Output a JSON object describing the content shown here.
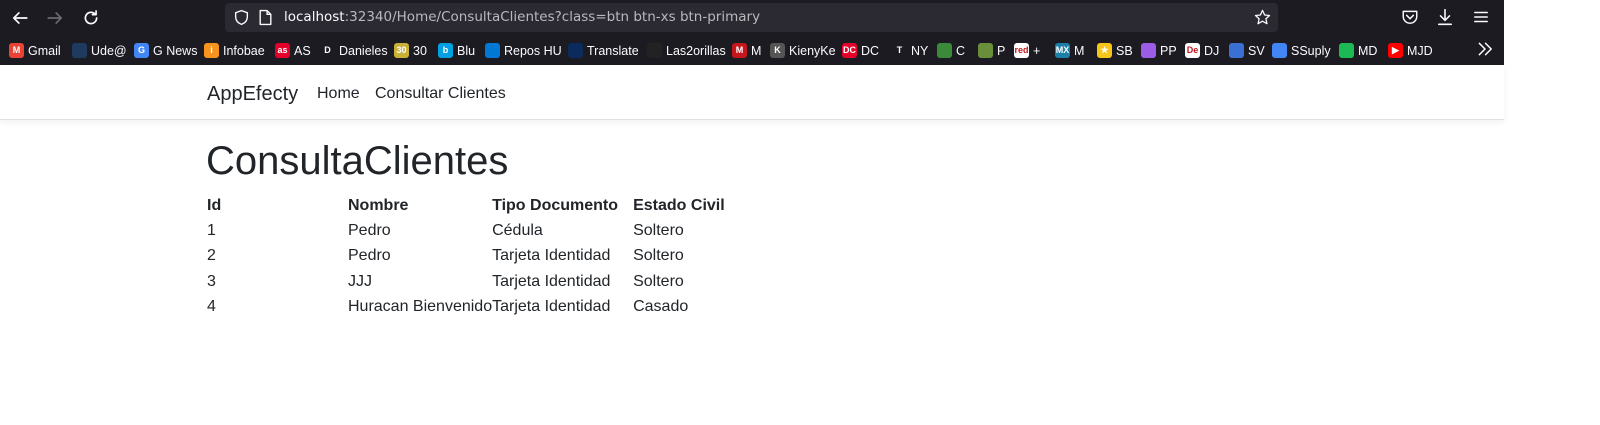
{
  "browser": {
    "url_host": "localhost",
    "url_rest": ":32340/Home/ConsultaClientes?class=btn btn-xs btn-primary",
    "colors": {
      "chrome_bg": "#1c1b22",
      "urlbar_bg": "#2b2a33",
      "text": "#fbfbfe"
    }
  },
  "bookmarks": [
    {
      "label": "Gmail",
      "icon": "gmail-icon",
      "color": "#ea4335",
      "glyph": "M"
    },
    {
      "label": "Ude@",
      "icon": "udea-icon",
      "color": "#1e3a5f",
      "glyph": ""
    },
    {
      "label": "G News",
      "icon": "google-news-icon",
      "color": "#4285f4",
      "glyph": "G"
    },
    {
      "label": "Infobae",
      "icon": "infobae-icon",
      "color": "#f7941d",
      "glyph": "i"
    },
    {
      "label": "AS",
      "icon": "as-icon",
      "color": "#e4002b",
      "glyph": "as"
    },
    {
      "label": "Danieles",
      "icon": "danieles-icon",
      "color": "#1c1b22",
      "glyph": "D"
    },
    {
      "label": "30",
      "icon": "thirty-icon",
      "color": "#c9b037",
      "glyph": "30"
    },
    {
      "label": "Blu",
      "icon": "blu-icon",
      "color": "#00a0e3",
      "glyph": "b"
    },
    {
      "label": "Repos HU",
      "icon": "azure-devops-icon",
      "color": "#0078d4",
      "glyph": ""
    },
    {
      "label": "Translate",
      "icon": "translate-icon",
      "color": "#0b2b5c",
      "glyph": ""
    },
    {
      "label": "Las2orillas",
      "icon": "las2orillas-icon",
      "color": "#222222",
      "glyph": ""
    },
    {
      "label": "M",
      "icon": "m-red-icon",
      "color": "#c4161c",
      "glyph": "M"
    },
    {
      "label": "KienyKe",
      "icon": "kienyke-icon",
      "color": "#555555",
      "glyph": "K"
    },
    {
      "label": "DC",
      "icon": "dc-icon",
      "color": "#e4002b",
      "glyph": "DC"
    },
    {
      "label": "NY",
      "icon": "nytimes-icon",
      "color": "#1c1b22",
      "glyph": "T"
    },
    {
      "label": "C",
      "icon": "c-tree-icon",
      "color": "#3a8a3a",
      "glyph": ""
    },
    {
      "label": "P",
      "icon": "p-target-icon",
      "color": "#6a8f3a",
      "glyph": ""
    },
    {
      "label": "+",
      "icon": "redmas-icon",
      "color": "#ffffff",
      "glyph": "red"
    },
    {
      "label": "M",
      "icon": "mx-icon",
      "color": "#1b7fa8",
      "glyph": "MX"
    },
    {
      "label": "SB",
      "icon": "star-icon",
      "color": "#f5c518",
      "glyph": "★"
    },
    {
      "label": "PP",
      "icon": "podcast-icon",
      "color": "#9b5de5",
      "glyph": ""
    },
    {
      "label": "DJ",
      "icon": "dj-icon",
      "color": "#ffffff",
      "glyph": "De"
    },
    {
      "label": "SV",
      "icon": "sv-icon",
      "color": "#3b6fd4",
      "glyph": ""
    },
    {
      "label": "SSuply",
      "icon": "google-docs-icon",
      "color": "#4285f4",
      "glyph": ""
    },
    {
      "label": "MD",
      "icon": "spotify-icon",
      "color": "#1db954",
      "glyph": ""
    },
    {
      "label": "MJD",
      "icon": "youtube-icon",
      "color": "#ff0000",
      "glyph": "▶"
    }
  ],
  "app": {
    "brand": "AppEfecty",
    "nav": [
      "Home",
      "Consultar Clientes"
    ],
    "title": "ConsultaClientes"
  },
  "table": {
    "headers": [
      "Id",
      "Nombre",
      "Tipo Documento",
      "Estado Civil"
    ],
    "rows": [
      [
        "1",
        "Pedro",
        "Cédula",
        "Soltero"
      ],
      [
        "2",
        "Pedro",
        "Tarjeta Identidad",
        "Soltero"
      ],
      [
        "3",
        "JJJ",
        "Tarjeta Identidad",
        "Soltero"
      ],
      [
        "4",
        "Huracan Bienvenido",
        "Tarjeta Identidad",
        "Casado"
      ]
    ]
  }
}
